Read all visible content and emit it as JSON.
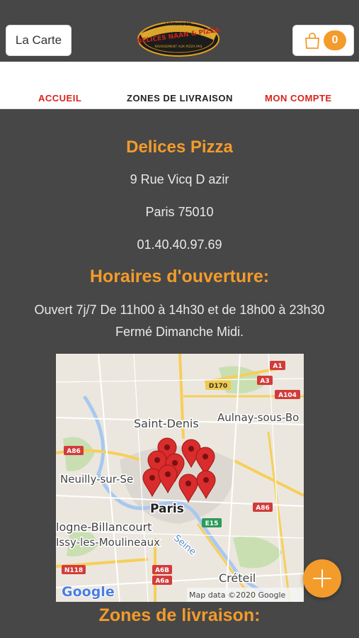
{
  "header": {
    "carte_label": "La Carte",
    "logo_top": "LIVRAISON",
    "logo_name": "DELICES NAAN & PIZZA",
    "logo_sub": "RAVISSEMENT AUX PIZZA PAS",
    "cart_count": "0"
  },
  "nav": {
    "items": [
      {
        "label": "ACCUEIL",
        "color": "#d9231d"
      },
      {
        "label": "ZONES DE LIVRAISON",
        "color": "#222222"
      },
      {
        "label": "MON COMPTE",
        "color": "#d9231d"
      }
    ]
  },
  "restaurant": {
    "name": "Delices Pizza",
    "address1": "9 Rue Vicq D azir",
    "address2": "Paris 75010",
    "phone": "01.40.40.97.69"
  },
  "hours": {
    "title": "Horaires d'ouverture:",
    "line1": "Ouvert 7j/7 De 11h00 à 14h30 et de 18h00 à 23h30",
    "line2": "Fermé Dimanche Midi."
  },
  "map": {
    "labels": {
      "saint_denis": "Saint-Denis",
      "aulnay": "Aulnay-sous-Bo",
      "neuilly": "Neuilly-sur-Se",
      "paris": "Paris",
      "boulogne": "logne-Billancourt",
      "issy": "Issy-les-Moulineaux",
      "seine": "Seine",
      "creteil": "Créteil",
      "google": "Google",
      "attribution": "Map data ©2020 Google"
    },
    "shields": {
      "a1": "A1",
      "d170": "D170",
      "a3": "A3",
      "a104": "A104",
      "a86_w": "A86",
      "a86_e": "A86",
      "e15": "E15",
      "n118": "N118",
      "a6b": "A6B",
      "a6a": "A6a"
    }
  },
  "zones": {
    "title": "Zones de livraison:"
  },
  "colors": {
    "accent": "#f39b2b",
    "background": "#474747",
    "nav_red": "#d9231d",
    "pin_red": "#d92c2c"
  }
}
